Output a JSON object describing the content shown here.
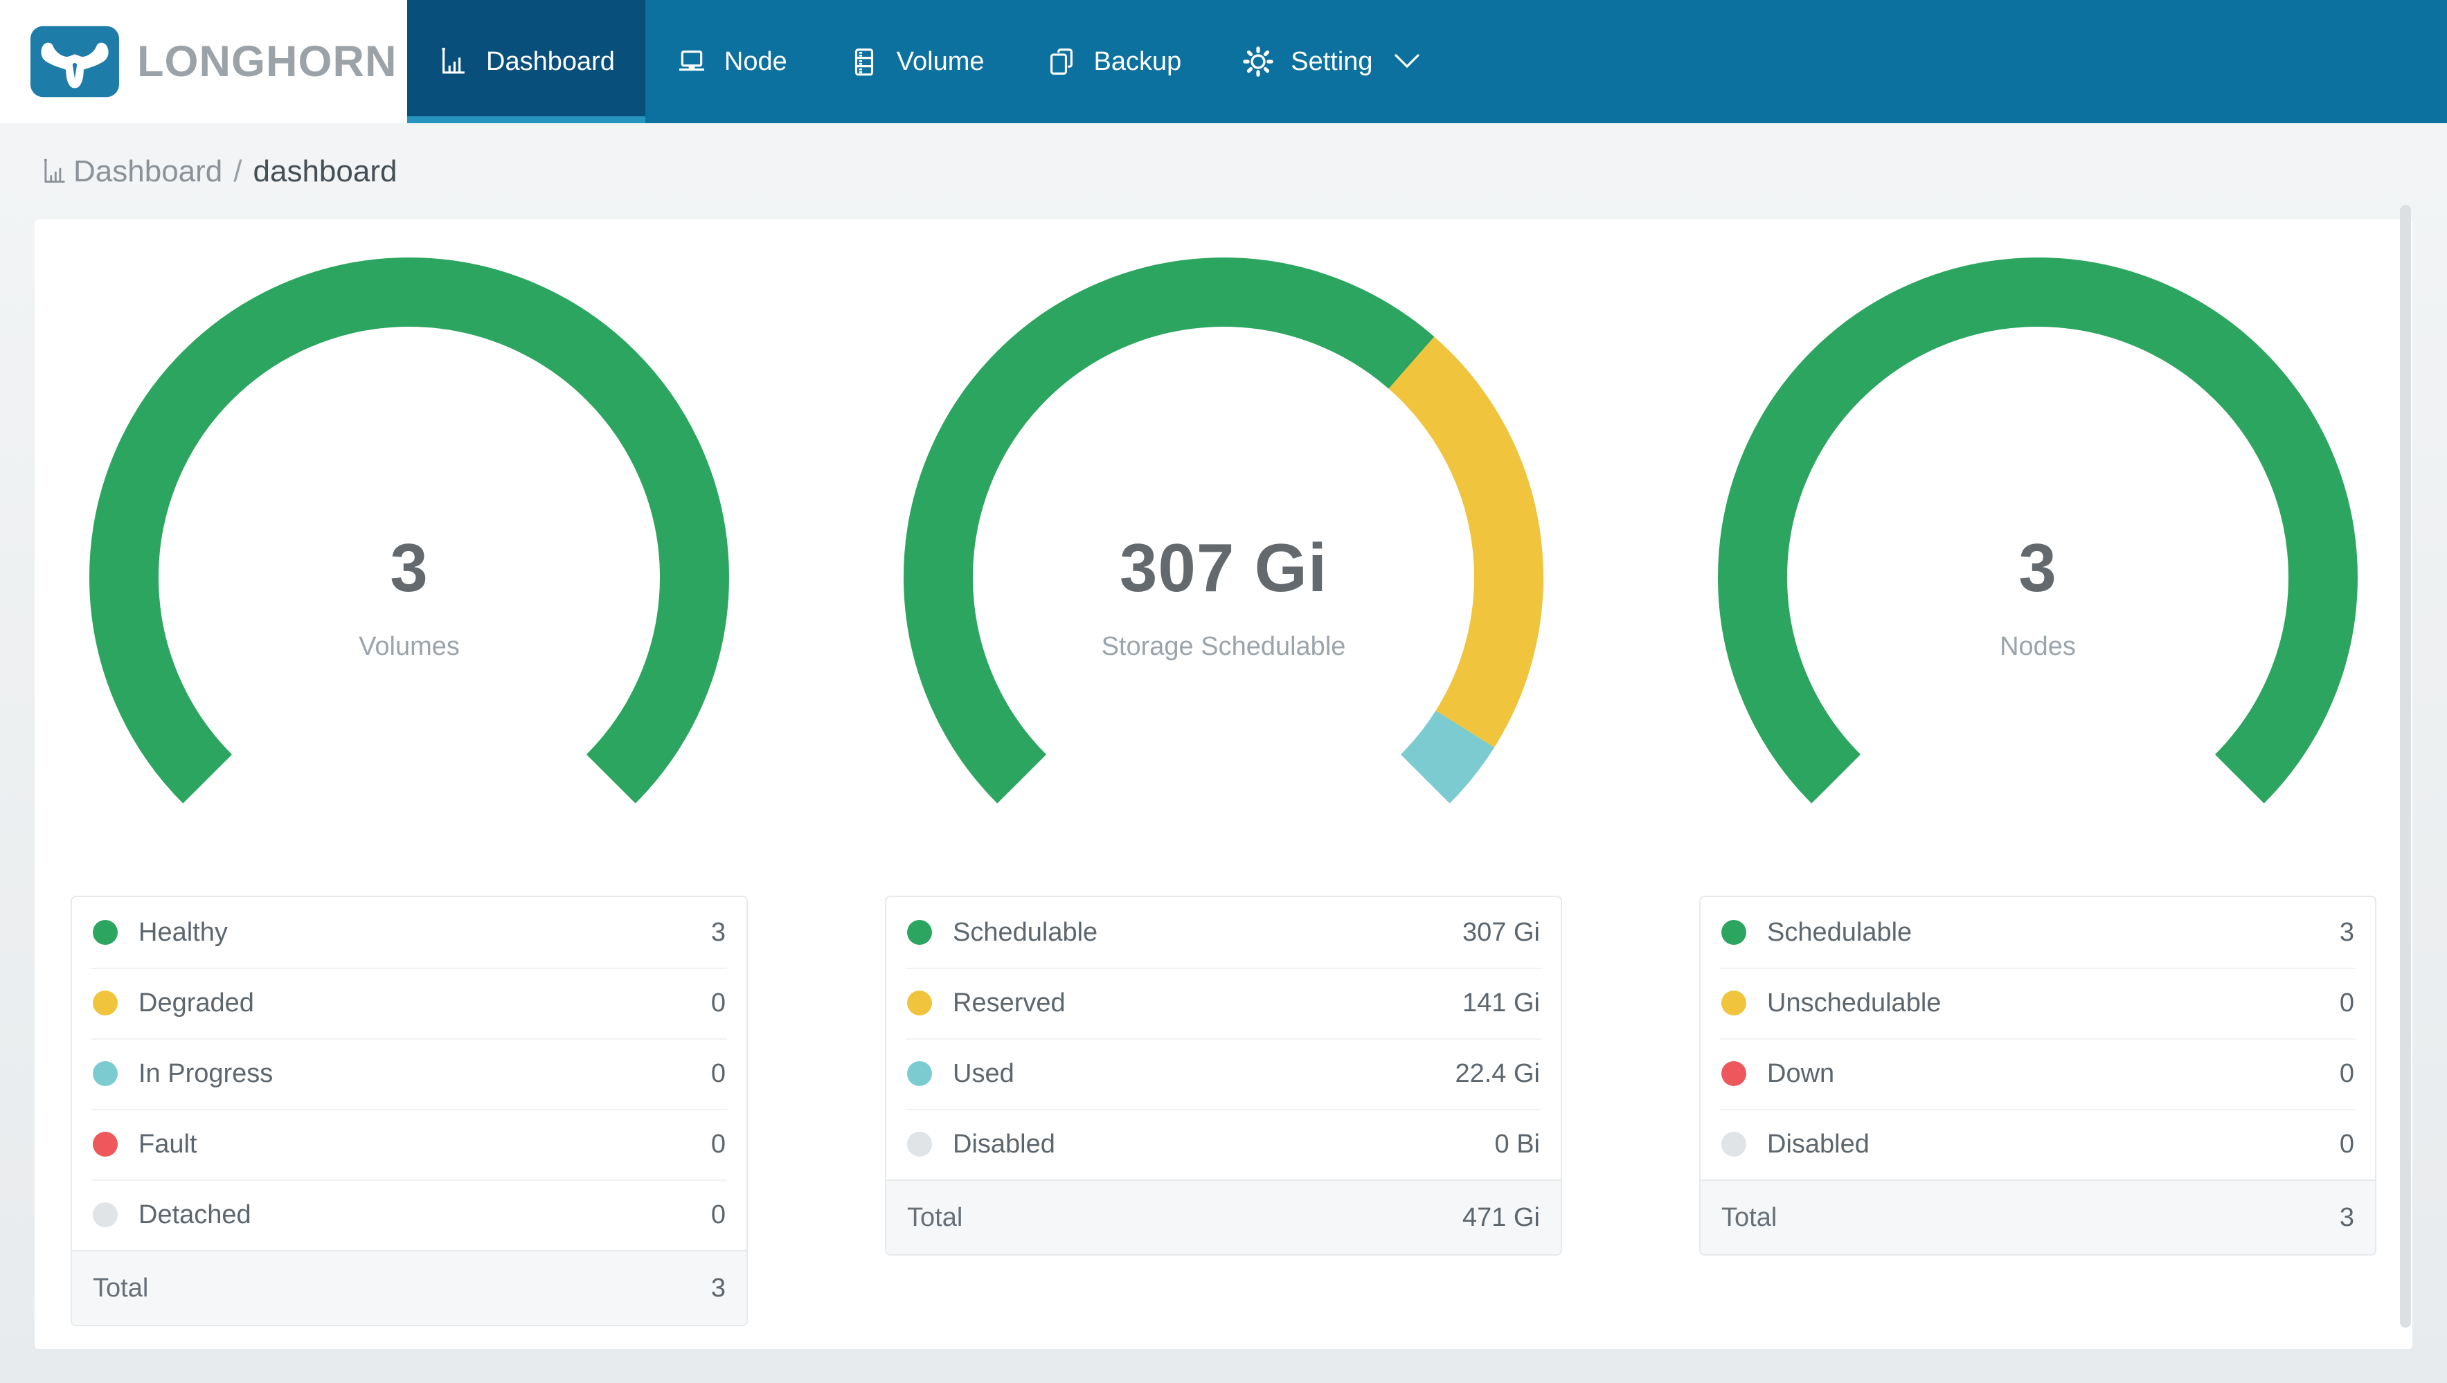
{
  "brand": {
    "name": "LONGHORN",
    "logo_icon": "longhorn-bull-icon"
  },
  "nav": {
    "items": [
      {
        "label": "Dashboard",
        "icon": "bar-chart-icon",
        "active": true
      },
      {
        "label": "Node",
        "icon": "laptop-icon",
        "active": false
      },
      {
        "label": "Volume",
        "icon": "database-icon",
        "active": false
      },
      {
        "label": "Backup",
        "icon": "copy-icon",
        "active": false
      },
      {
        "label": "Setting",
        "icon": "gear-icon",
        "active": false,
        "has_submenu": true,
        "submenu_icon": "chevron-down-icon"
      }
    ]
  },
  "breadcrumb": {
    "icon": "bar-chart-icon",
    "section": "Dashboard",
    "separator": "/",
    "page": "dashboard"
  },
  "colors": {
    "navbar": "#0C719E",
    "navbar_active": "#084F7C",
    "active_indicator": "#2696BE",
    "logo_blue": "#1E7CA8",
    "green": "#2BA55F",
    "yellow": "#F0C53D",
    "teal": "#7CCBD1",
    "red": "#EE575C",
    "gray": "#E0E4E7"
  },
  "chart_data": [
    {
      "type": "donut-gauge",
      "name": "volumes",
      "start_angle_deg": 225,
      "sweep_deg": 270,
      "center": {
        "value": "3",
        "label": "Volumes"
      },
      "segments": [
        {
          "label": "Healthy",
          "value": 3,
          "display": "3",
          "color": "#2BA55F"
        },
        {
          "label": "Degraded",
          "value": 0,
          "display": "0",
          "color": "#F0C53D"
        },
        {
          "label": "In Progress",
          "value": 0,
          "display": "0",
          "color": "#7CCBD1"
        },
        {
          "label": "Fault",
          "value": 0,
          "display": "0",
          "color": "#EE575C"
        },
        {
          "label": "Detached",
          "value": 0,
          "display": "0",
          "color": "#E0E4E7"
        }
      ],
      "total": {
        "label": "Total",
        "value": 3,
        "display": "3"
      }
    },
    {
      "type": "donut-gauge",
      "name": "storage-schedulable",
      "start_angle_deg": 225,
      "sweep_deg": 270,
      "center": {
        "value": "307 Gi",
        "label": "Storage Schedulable"
      },
      "segments": [
        {
          "label": "Schedulable",
          "value": 307,
          "display": "307 Gi",
          "color": "#2BA55F"
        },
        {
          "label": "Reserved",
          "value": 141,
          "display": "141 Gi",
          "color": "#F0C53D"
        },
        {
          "label": "Used",
          "value": 22.4,
          "display": "22.4 Gi",
          "color": "#7CCBD1"
        },
        {
          "label": "Disabled",
          "value": 0,
          "display": "0 Bi",
          "color": "#E0E4E7"
        }
      ],
      "total": {
        "label": "Total",
        "value": 471,
        "display": "471 Gi"
      }
    },
    {
      "type": "donut-gauge",
      "name": "nodes",
      "start_angle_deg": 225,
      "sweep_deg": 270,
      "center": {
        "value": "3",
        "label": "Nodes"
      },
      "segments": [
        {
          "label": "Schedulable",
          "value": 3,
          "display": "3",
          "color": "#2BA55F"
        },
        {
          "label": "Unschedulable",
          "value": 0,
          "display": "0",
          "color": "#F0C53D"
        },
        {
          "label": "Down",
          "value": 0,
          "display": "0",
          "color": "#EE575C"
        },
        {
          "label": "Disabled",
          "value": 0,
          "display": "0",
          "color": "#E0E4E7"
        }
      ],
      "total": {
        "label": "Total",
        "value": 3,
        "display": "3"
      }
    }
  ]
}
